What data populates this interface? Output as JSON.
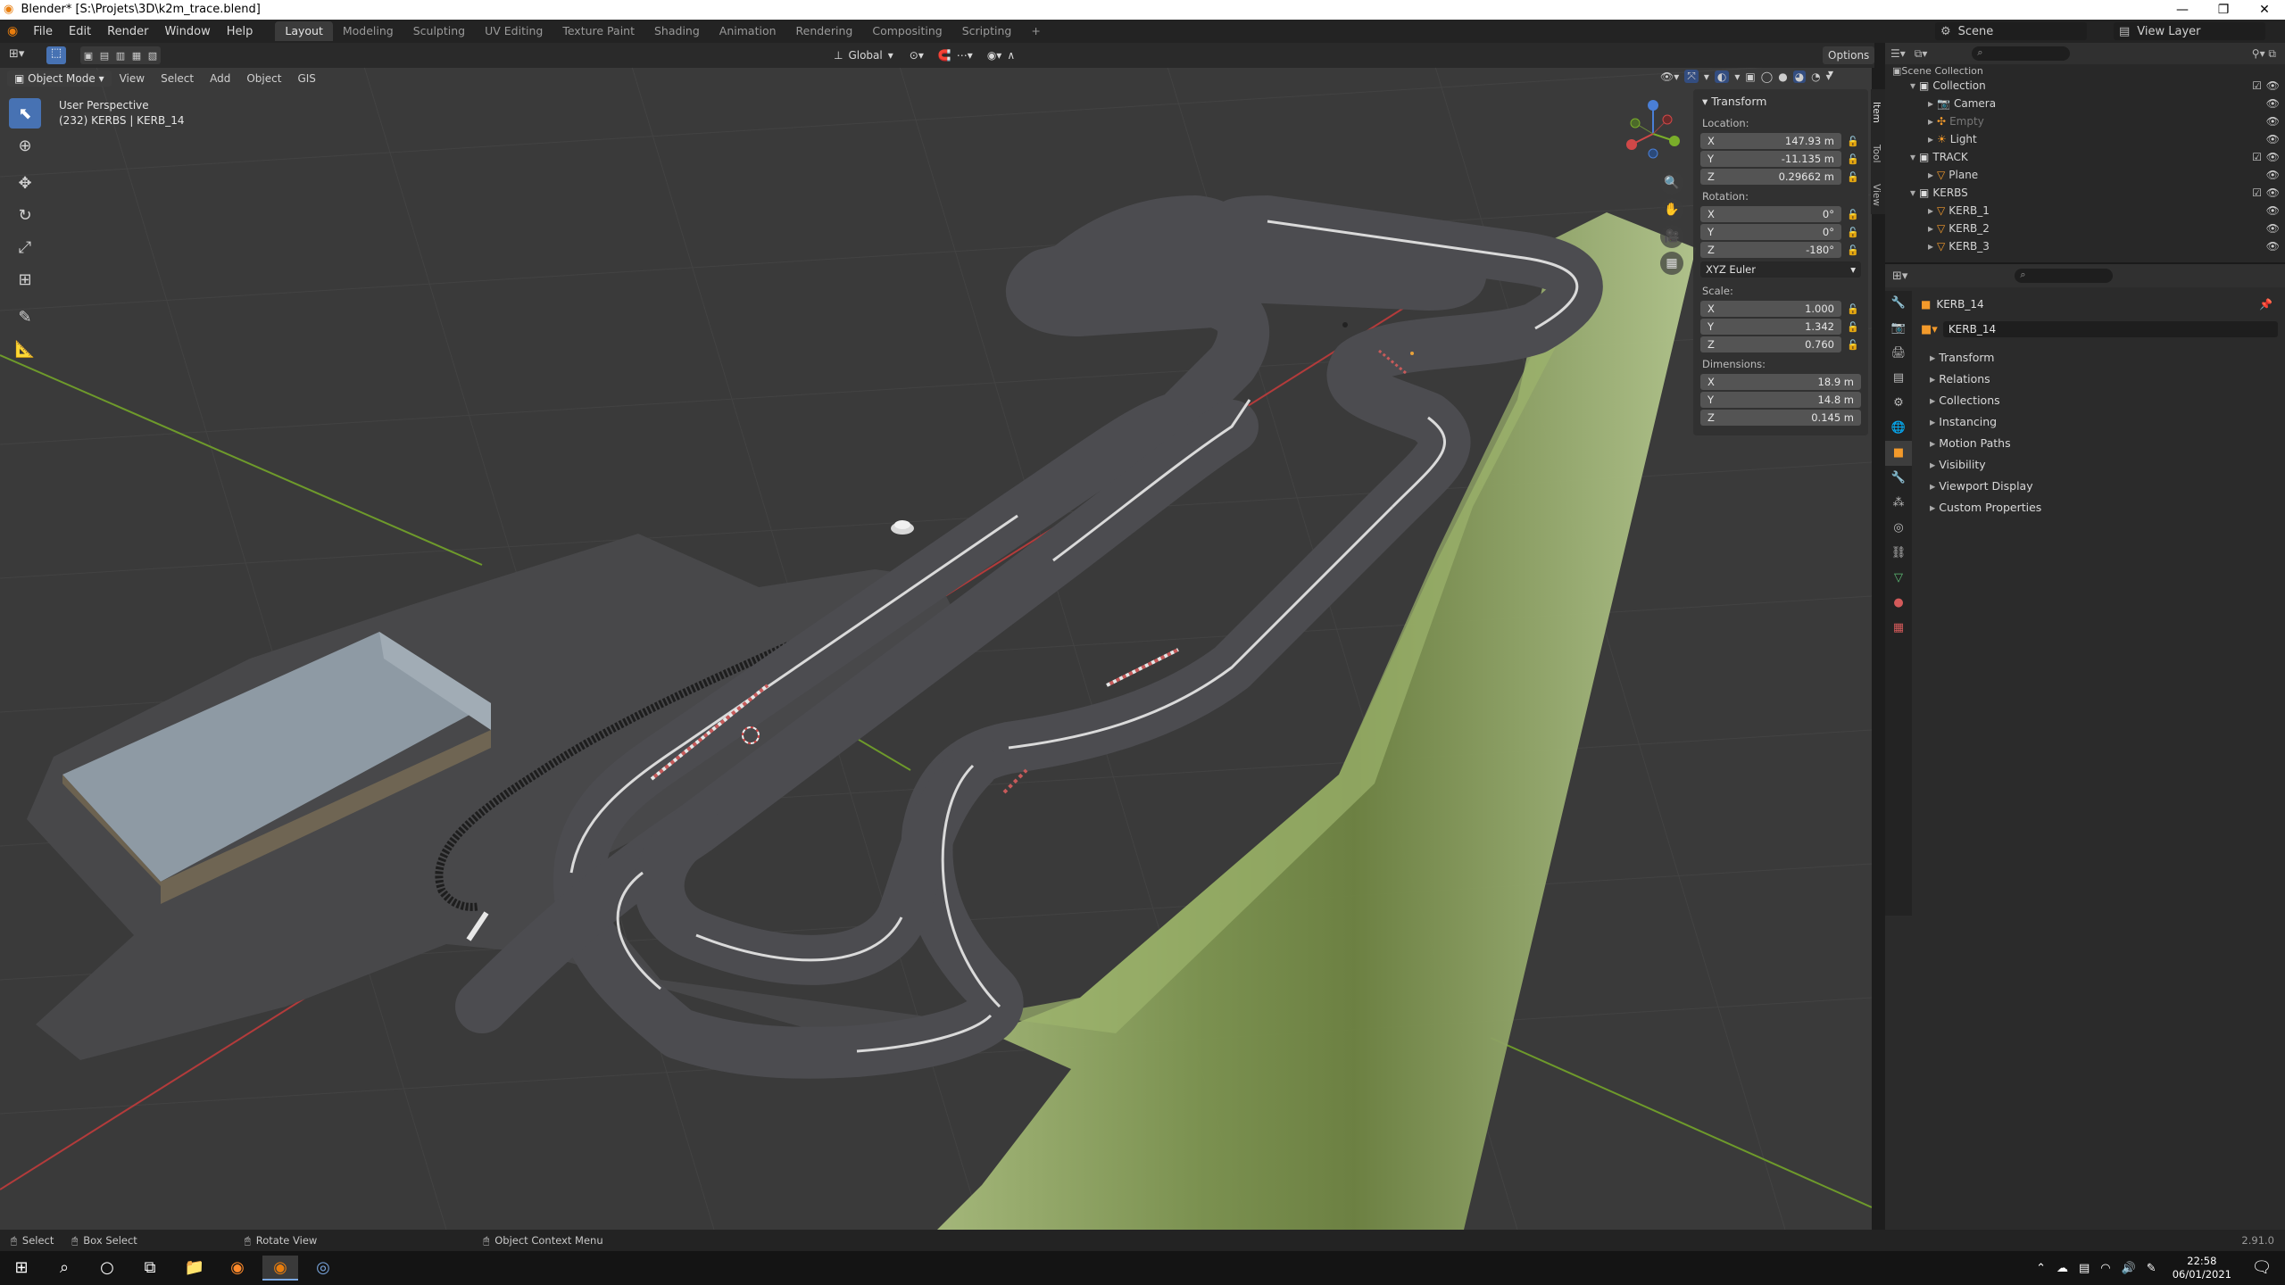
{
  "title_bar": {
    "title": "Blender* [S:\\Projets\\3D\\k2m_trace.blend]",
    "minimize": "—",
    "maximize": "❐",
    "close": "✕"
  },
  "menu": {
    "items": [
      "File",
      "Edit",
      "Render",
      "Window",
      "Help"
    ]
  },
  "workspaces": {
    "tabs": [
      "Layout",
      "Modeling",
      "Sculpting",
      "UV Editing",
      "Texture Paint",
      "Shading",
      "Animation",
      "Rendering",
      "Compositing",
      "Scripting"
    ],
    "active": "Layout",
    "add": "+"
  },
  "scene": {
    "label": "Scene",
    "view_layer": "View Layer"
  },
  "tool_header": {
    "transform_orientation": "Global",
    "options": "Options"
  },
  "viewport_header": {
    "mode": "Object Mode",
    "menus": [
      "View",
      "Select",
      "Add",
      "Object",
      "GIS"
    ]
  },
  "viewport": {
    "perspective": "User Perspective",
    "object_info": "(232) KERBS | KERB_14"
  },
  "n_panel": {
    "title": "Transform",
    "location_label": "Location:",
    "location": [
      {
        "axis": "X",
        "value": "147.93 m"
      },
      {
        "axis": "Y",
        "value": "-11.135 m"
      },
      {
        "axis": "Z",
        "value": "0.29662 m"
      }
    ],
    "rotation_label": "Rotation:",
    "rotation": [
      {
        "axis": "X",
        "value": "0°"
      },
      {
        "axis": "Y",
        "value": "0°"
      },
      {
        "axis": "Z",
        "value": "-180°"
      }
    ],
    "rotation_mode": "XYZ Euler",
    "scale_label": "Scale:",
    "scale": [
      {
        "axis": "X",
        "value": "1.000"
      },
      {
        "axis": "Y",
        "value": "1.342"
      },
      {
        "axis": "Z",
        "value": "0.760"
      }
    ],
    "dimensions_label": "Dimensions:",
    "dimensions": [
      {
        "axis": "X",
        "value": "18.9 m"
      },
      {
        "axis": "Y",
        "value": "14.8 m"
      },
      {
        "axis": "Z",
        "value": "0.145 m"
      }
    ],
    "side_tabs": [
      "Item",
      "Tool",
      "View"
    ]
  },
  "outliner": {
    "header": "Scene Collection",
    "rows": [
      {
        "name": "Collection",
        "type": "collection",
        "indent": 1
      },
      {
        "name": "Camera",
        "type": "camera",
        "indent": 2
      },
      {
        "name": "Empty",
        "type": "empty",
        "indent": 2
      },
      {
        "name": "Light",
        "type": "light",
        "indent": 2
      },
      {
        "name": "TRACK",
        "type": "collection",
        "indent": 1
      },
      {
        "name": "Plane",
        "type": "mesh",
        "indent": 2
      },
      {
        "name": "KERBS",
        "type": "collection",
        "indent": 1
      },
      {
        "name": "KERB_1",
        "type": "mesh",
        "indent": 2
      },
      {
        "name": "KERB_2",
        "type": "mesh",
        "indent": 2
      },
      {
        "name": "KERB_3",
        "type": "mesh",
        "indent": 2
      }
    ]
  },
  "properties": {
    "object_name": "KERB_14",
    "data_name": "KERB_14",
    "sections": [
      "Transform",
      "Relations",
      "Collections",
      "Instancing",
      "Motion Paths",
      "Visibility",
      "Viewport Display",
      "Custom Properties"
    ]
  },
  "status_bar": {
    "select": "Select",
    "box_select": "Box Select",
    "rotate_view": "Rotate View",
    "context_menu": "Object Context Menu",
    "version": "2.91.0"
  },
  "taskbar": {
    "time": "22:58",
    "date": "06/01/2021"
  },
  "colors": {
    "grid_bg": "#3a3a3a",
    "track": "#4a4a4e",
    "kerb_line": "#d8d8d8",
    "grass": "#8ea860",
    "x_axis": "#b33b3b",
    "y_axis": "#6e9a2b",
    "accent": "#4772b3"
  }
}
